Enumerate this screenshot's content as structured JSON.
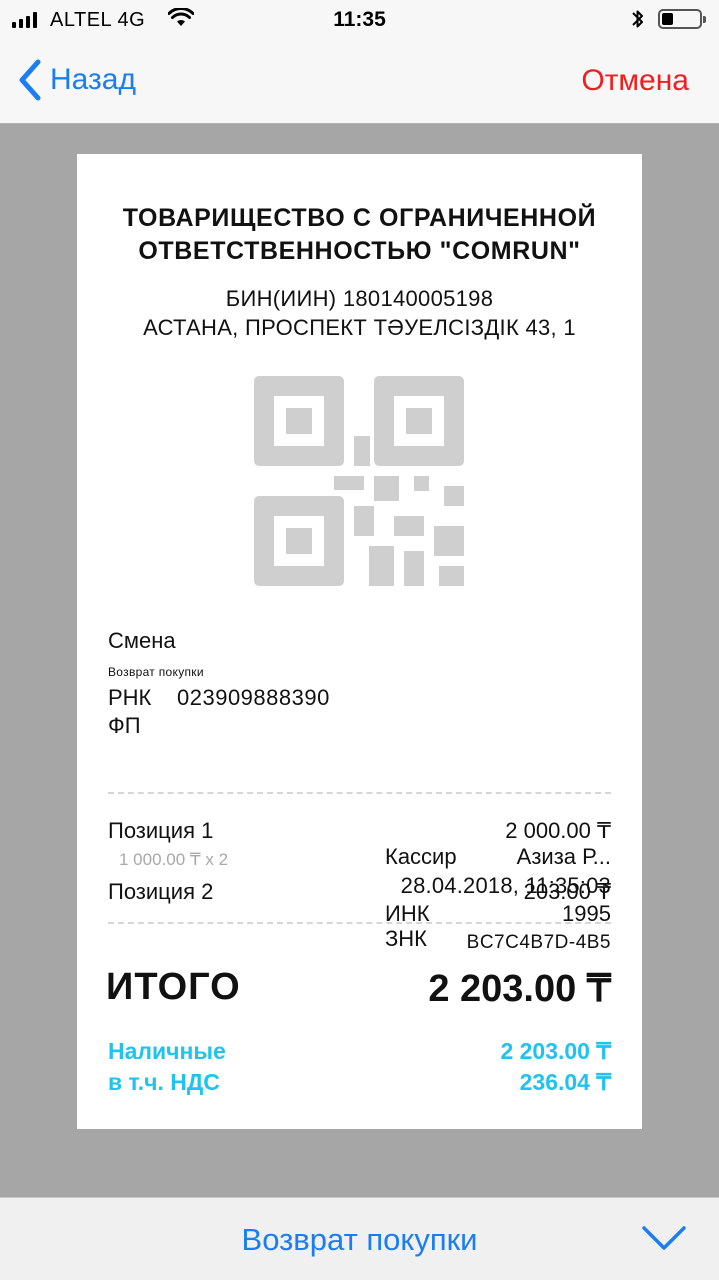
{
  "status_bar": {
    "carrier": "ALTEL 4G",
    "time": "11:35",
    "battery_level": 0.3,
    "signal_bars": 4
  },
  "nav": {
    "back_label": "Назад",
    "cancel_label": "Отмена"
  },
  "receipt": {
    "company": "ТОВАРИЩЕСТВО С ОГРАНИЧЕННОЙ ОТВЕТСТВЕННОСТЬЮ \"COMRUN\"",
    "bin": "БИН(ИИН) 180140005198",
    "address": "АСТАНА, ПРОСПЕКТ ТӘУЕЛСІЗДІК 43, 1",
    "shift_label": "Смена",
    "operation_type": "Возврат покупки",
    "rnk_label": "РНК",
    "rnk_value": "023909888390",
    "fp_label": "ФП",
    "cashier_label": "Кассир",
    "cashier_value": "Азиза Р...",
    "datetime": "28.04.2018, 11:35:03",
    "ink_label": "ИНК",
    "ink_value": "1995",
    "znk_label": "ЗНК",
    "znk_value": "BC7C4B7D-4B5",
    "items": [
      {
        "name": "Позиция 1",
        "price": "2 000.00 ₸",
        "detail": "1 000.00 ₸ x 2"
      },
      {
        "name": "Позиция 2",
        "price": "203.00 ₸"
      }
    ],
    "total_label": "ИТОГО",
    "total_value": "2 203.00 ₸",
    "payment_label": "Наличные",
    "payment_value": "2 203.00 ₸",
    "vat_label": "в т.ч. НДС",
    "vat_value": "236.04 ₸"
  },
  "bottom": {
    "title": "Возврат покупки"
  },
  "colors": {
    "accent": "#1a7ef2",
    "cancel": "#f21d1d",
    "payment": "#1ec3ee",
    "backdrop": "#a6a6a6",
    "qr_placeholder": "#cfcfcf"
  },
  "icons": {
    "back": "chevron-left-icon",
    "collapse": "chevron-down-icon",
    "qr": "qr-code-icon",
    "wifi": "wifi-icon",
    "bluetooth": "bluetooth-icon",
    "battery": "battery-icon",
    "signal": "signal-icon"
  }
}
